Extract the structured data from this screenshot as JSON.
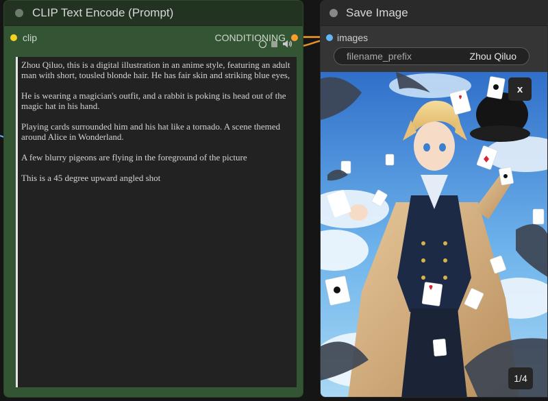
{
  "clip_node": {
    "title": "CLIP Text Encode (Prompt)",
    "input_label": "clip",
    "output_label": "CONDITIONING",
    "input_color": "#f5d122",
    "output_color": "#ff9d2a",
    "prompt_text": "Zhou Qiluo, this is a digital illustration in an anime style, featuring an adult man with short, tousled blonde hair. He has fair skin and striking blue eyes,\n\nHe is wearing a magician's outfit, and a rabbit is poking its head out of the magic hat in his hand.\n\nPlaying cards surrounded him and his hat like a tornado. A scene themed around Alice in Wonderland.\n\nA few blurry pigeons are flying in the foreground of the picture\n\nThis is a 45 degree upward angled shot"
  },
  "save_node": {
    "title": "Save Image",
    "input_label": "images",
    "input_color": "#64b5f6",
    "filename_prefix_label": "filename_prefix",
    "filename_prefix_value": "Zhou Qiluo",
    "close_label": "x",
    "page_counter": "1/4"
  },
  "icons": {
    "status_circle": "circle-outline-icon",
    "stop": "stop-square-icon",
    "sound": "speaker-icon"
  }
}
